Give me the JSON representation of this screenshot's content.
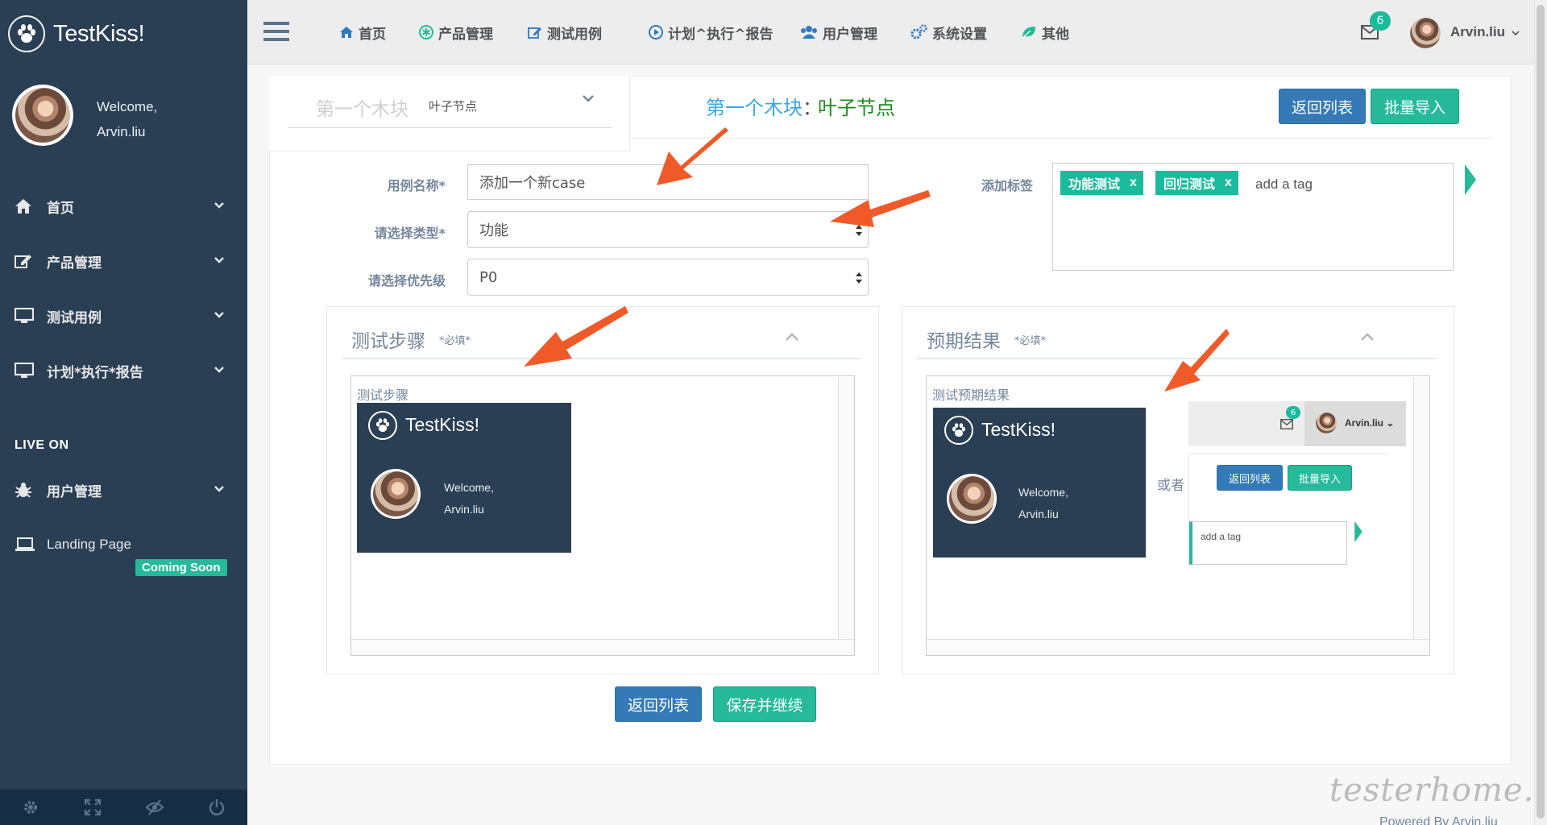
{
  "brand": {
    "name": "TestKiss!"
  },
  "sidebar": {
    "welcome": "Welcome,",
    "user": "Arvin.liu",
    "items": [
      {
        "label": "首页",
        "icon": "home-icon"
      },
      {
        "label": "产品管理",
        "icon": "edit-icon"
      },
      {
        "label": "测试用例",
        "icon": "desktop-icon"
      },
      {
        "label": "计划*执行*报告",
        "icon": "desktop-icon"
      }
    ],
    "section_title": "LIVE ON",
    "live_items": [
      {
        "label": "用户管理",
        "icon": "bug-icon"
      },
      {
        "label": "Landing Page",
        "icon": "laptop-icon"
      }
    ],
    "coming_soon": "Coming Soon",
    "footer_icons": [
      "settings-icon",
      "fullscreen-icon",
      "eye-slash-icon",
      "power-icon"
    ]
  },
  "topnav": {
    "items": [
      {
        "label": "首页",
        "icon": "home-icon"
      },
      {
        "label": "产品管理",
        "icon": "asterisk-icon"
      },
      {
        "label": "测试用例",
        "icon": "edit-icon"
      },
      {
        "label": "计划^执行^报告",
        "icon": "play-circle-icon"
      },
      {
        "label": "用户管理",
        "icon": "users-icon"
      },
      {
        "label": "系统设置",
        "icon": "cogs-icon"
      },
      {
        "label": "其他",
        "icon": "leaf-icon"
      }
    ],
    "mail_count": "6",
    "user": "Arvin.liu"
  },
  "tree": {
    "placeholder": "第一个木块",
    "node": "叶子节点"
  },
  "title": {
    "module": "第一个木块",
    "sep": "：",
    "node": "叶子节点"
  },
  "actions": {
    "back": "返回列表",
    "batch_import": "批量导入"
  },
  "form": {
    "case_name_label": "用例名称*",
    "case_name_value": "添加一个新case",
    "type_label": "请选择类型*",
    "type_value": "功能",
    "priority_label": "请选择优先级",
    "priority_value": "P0",
    "tags_label": "添加标签",
    "tags": [
      "功能测试",
      "回归测试"
    ],
    "tag_remove": "x",
    "tag_placeholder": "add a tag"
  },
  "steps": {
    "title": "测试步骤",
    "required": "*必填*",
    "editor_label": "测试步骤"
  },
  "expected": {
    "title": "预期结果",
    "required": "*必填*",
    "editor_label": "测试预期结果",
    "or": "或者"
  },
  "mini": {
    "brand": "TestKiss!",
    "welcome": "Welcome,",
    "user": "Arvin.liu",
    "mail_count": "6",
    "back": "返回列表",
    "batch_import": "批量导入",
    "tag_placeholder": "add a tag"
  },
  "bottom": {
    "back": "返回列表",
    "save_continue": "保存并继续"
  },
  "footer": {
    "watermark": "testerhome.com",
    "powered": "Powered By Arvin.liu"
  },
  "colors": {
    "sidebar": "#2a3f54",
    "primary": "#337ab7",
    "success": "#26b99a",
    "arrow": "#f05a28"
  }
}
